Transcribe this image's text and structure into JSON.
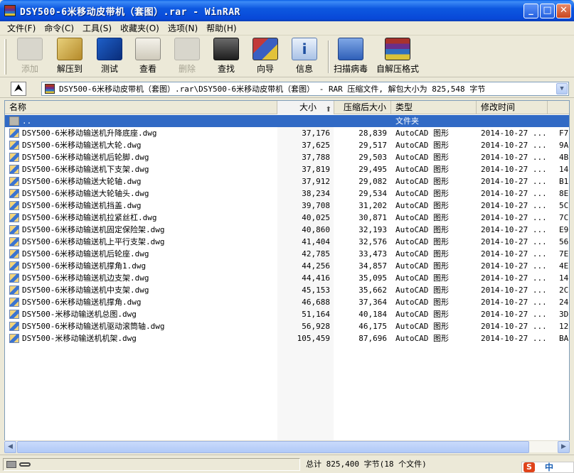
{
  "window": {
    "title": "DSY500-6米移动皮带机（套图）.rar - WinRAR",
    "buttons": {
      "minimize": "_",
      "maximize": "□",
      "close": "✕"
    }
  },
  "menu": [
    "文件(F)",
    "命令(C)",
    "工具(S)",
    "收藏夹(O)",
    "选项(N)",
    "帮助(H)"
  ],
  "toolbar": {
    "buttons": [
      {
        "label": "添加",
        "icon": "add-icon",
        "enabled": false
      },
      {
        "label": "解压到",
        "icon": "extract-to-icon",
        "enabled": true
      },
      {
        "label": "测试",
        "icon": "test-icon",
        "enabled": true
      },
      {
        "label": "查看",
        "icon": "view-icon",
        "enabled": true
      },
      {
        "label": "删除",
        "icon": "delete-icon",
        "enabled": false
      },
      {
        "label": "查找",
        "icon": "find-icon",
        "enabled": true
      },
      {
        "label": "向导",
        "icon": "wizard-icon",
        "enabled": true
      },
      {
        "label": "信息",
        "icon": "info-icon",
        "enabled": true
      },
      {
        "label": "扫描病毒",
        "icon": "virus-scan-icon",
        "enabled": true
      },
      {
        "label": "自解压格式",
        "icon": "sfx-icon",
        "enabled": true
      }
    ]
  },
  "address": {
    "path": "DSY500-6米移动皮带机（套图）.rar\\DSY500-6米移动皮带机（套图） - RAR 压缩文件, 解包大小为 825,548 字节"
  },
  "columns": {
    "name": "名称",
    "size": "大小",
    "packed": "压缩后大小",
    "type": "类型",
    "modified": "修改时间"
  },
  "parent_row": {
    "name": "..",
    "type": "文件夹"
  },
  "files": [
    {
      "name": "DSY500-6米移动输送机升降底座.dwg",
      "size": "37,176",
      "packed": "28,839",
      "type": "AutoCAD 图形",
      "modified": "2014-10-27 ...",
      "crc": "F7"
    },
    {
      "name": "DSY500-6米移动输送机大轮.dwg",
      "size": "37,625",
      "packed": "29,517",
      "type": "AutoCAD 图形",
      "modified": "2014-10-27 ...",
      "crc": "9A"
    },
    {
      "name": "DSY500-6米移动输送机后轮脚.dwg",
      "size": "37,788",
      "packed": "29,503",
      "type": "AutoCAD 图形",
      "modified": "2014-10-27 ...",
      "crc": "4B"
    },
    {
      "name": "DSY500-6米移动输送机下支架.dwg",
      "size": "37,819",
      "packed": "29,495",
      "type": "AutoCAD 图形",
      "modified": "2014-10-27 ...",
      "crc": "14"
    },
    {
      "name": "DSY500-6米移动输送大轮轴.dwg",
      "size": "37,912",
      "packed": "29,082",
      "type": "AutoCAD 图形",
      "modified": "2014-10-27 ...",
      "crc": "B1"
    },
    {
      "name": "DSY500-6米移动输送大轮轴头.dwg",
      "size": "38,234",
      "packed": "29,534",
      "type": "AutoCAD 图形",
      "modified": "2014-10-27 ...",
      "crc": "8E"
    },
    {
      "name": "DSY500-6米移动输送机挡盖.dwg",
      "size": "39,708",
      "packed": "31,202",
      "type": "AutoCAD 图形",
      "modified": "2014-10-27 ...",
      "crc": "5C"
    },
    {
      "name": "DSY500-6米移动输送机拉紧丝杠.dwg",
      "size": "40,025",
      "packed": "30,871",
      "type": "AutoCAD 图形",
      "modified": "2014-10-27 ...",
      "crc": "7C"
    },
    {
      "name": "DSY500-6米移动输送机固定保险架.dwg",
      "size": "40,860",
      "packed": "32,193",
      "type": "AutoCAD 图形",
      "modified": "2014-10-27 ...",
      "crc": "E9"
    },
    {
      "name": "DSY500-6米移动输送机上平行支架.dwg",
      "size": "41,404",
      "packed": "32,576",
      "type": "AutoCAD 图形",
      "modified": "2014-10-27 ...",
      "crc": "56"
    },
    {
      "name": "DSY500-6米移动输送机后轮座.dwg",
      "size": "42,785",
      "packed": "33,473",
      "type": "AutoCAD 图形",
      "modified": "2014-10-27 ...",
      "crc": "7E"
    },
    {
      "name": "DSY500-6米移动输送机撑角1.dwg",
      "size": "44,256",
      "packed": "34,857",
      "type": "AutoCAD 图形",
      "modified": "2014-10-27 ...",
      "crc": "4E"
    },
    {
      "name": "DSY500-6米移动输送机边支架.dwg",
      "size": "44,416",
      "packed": "35,095",
      "type": "AutoCAD 图形",
      "modified": "2014-10-27 ...",
      "crc": "14"
    },
    {
      "name": "DSY500-6米移动输送机中支架.dwg",
      "size": "45,153",
      "packed": "35,662",
      "type": "AutoCAD 图形",
      "modified": "2014-10-27 ...",
      "crc": "2C"
    },
    {
      "name": "DSY500-6米移动输送机撑角.dwg",
      "size": "46,688",
      "packed": "37,364",
      "type": "AutoCAD 图形",
      "modified": "2014-10-27 ...",
      "crc": "24"
    },
    {
      "name": "DSY500-米移动输送机总图.dwg",
      "size": "51,164",
      "packed": "40,184",
      "type": "AutoCAD 图形",
      "modified": "2014-10-27 ...",
      "crc": "3D"
    },
    {
      "name": "DSY500-6米移动输送机驱动滚筒轴.dwg",
      "size": "56,928",
      "packed": "46,175",
      "type": "AutoCAD 图形",
      "modified": "2014-10-27 ...",
      "crc": "12"
    },
    {
      "name": "DSY500-米移动输送机机架.dwg",
      "size": "105,459",
      "packed": "87,696",
      "type": "AutoCAD 图形",
      "modified": "2014-10-27 ...",
      "crc": "BA"
    }
  ],
  "status": {
    "total": "总计 825,400 字节(18 个文件)"
  },
  "ime": {
    "logo": "S",
    "text": "中"
  }
}
